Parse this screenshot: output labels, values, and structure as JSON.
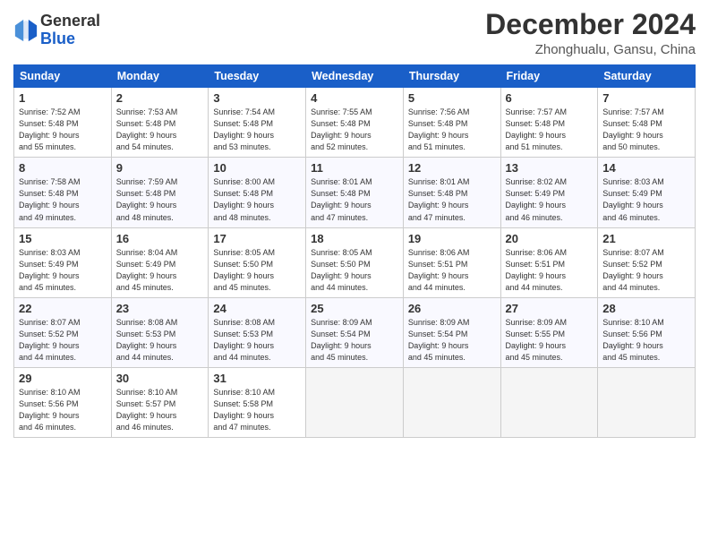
{
  "header": {
    "logo_line1": "General",
    "logo_line2": "Blue",
    "month_title": "December 2024",
    "location": "Zhonghualu, Gansu, China"
  },
  "days_of_week": [
    "Sunday",
    "Monday",
    "Tuesday",
    "Wednesday",
    "Thursday",
    "Friday",
    "Saturday"
  ],
  "weeks": [
    [
      {
        "day": "1",
        "sunrise": "7:52 AM",
        "sunset": "5:48 PM",
        "daylight_h": "9",
        "daylight_m": "55"
      },
      {
        "day": "2",
        "sunrise": "7:53 AM",
        "sunset": "5:48 PM",
        "daylight_h": "9",
        "daylight_m": "54"
      },
      {
        "day": "3",
        "sunrise": "7:54 AM",
        "sunset": "5:48 PM",
        "daylight_h": "9",
        "daylight_m": "53"
      },
      {
        "day": "4",
        "sunrise": "7:55 AM",
        "sunset": "5:48 PM",
        "daylight_h": "9",
        "daylight_m": "52"
      },
      {
        "day": "5",
        "sunrise": "7:56 AM",
        "sunset": "5:48 PM",
        "daylight_h": "9",
        "daylight_m": "51"
      },
      {
        "day": "6",
        "sunrise": "7:57 AM",
        "sunset": "5:48 PM",
        "daylight_h": "9",
        "daylight_m": "51"
      },
      {
        "day": "7",
        "sunrise": "7:57 AM",
        "sunset": "5:48 PM",
        "daylight_h": "9",
        "daylight_m": "50"
      }
    ],
    [
      {
        "day": "8",
        "sunrise": "7:58 AM",
        "sunset": "5:48 PM",
        "daylight_h": "9",
        "daylight_m": "49"
      },
      {
        "day": "9",
        "sunrise": "7:59 AM",
        "sunset": "5:48 PM",
        "daylight_h": "9",
        "daylight_m": "48"
      },
      {
        "day": "10",
        "sunrise": "8:00 AM",
        "sunset": "5:48 PM",
        "daylight_h": "9",
        "daylight_m": "48"
      },
      {
        "day": "11",
        "sunrise": "8:01 AM",
        "sunset": "5:48 PM",
        "daylight_h": "9",
        "daylight_m": "47"
      },
      {
        "day": "12",
        "sunrise": "8:01 AM",
        "sunset": "5:48 PM",
        "daylight_h": "9",
        "daylight_m": "47"
      },
      {
        "day": "13",
        "sunrise": "8:02 AM",
        "sunset": "5:49 PM",
        "daylight_h": "9",
        "daylight_m": "46"
      },
      {
        "day": "14",
        "sunrise": "8:03 AM",
        "sunset": "5:49 PM",
        "daylight_h": "9",
        "daylight_m": "46"
      }
    ],
    [
      {
        "day": "15",
        "sunrise": "8:03 AM",
        "sunset": "5:49 PM",
        "daylight_h": "9",
        "daylight_m": "45"
      },
      {
        "day": "16",
        "sunrise": "8:04 AM",
        "sunset": "5:49 PM",
        "daylight_h": "9",
        "daylight_m": "45"
      },
      {
        "day": "17",
        "sunrise": "8:05 AM",
        "sunset": "5:50 PM",
        "daylight_h": "9",
        "daylight_m": "45"
      },
      {
        "day": "18",
        "sunrise": "8:05 AM",
        "sunset": "5:50 PM",
        "daylight_h": "9",
        "daylight_m": "44"
      },
      {
        "day": "19",
        "sunrise": "8:06 AM",
        "sunset": "5:51 PM",
        "daylight_h": "9",
        "daylight_m": "44"
      },
      {
        "day": "20",
        "sunrise": "8:06 AM",
        "sunset": "5:51 PM",
        "daylight_h": "9",
        "daylight_m": "44"
      },
      {
        "day": "21",
        "sunrise": "8:07 AM",
        "sunset": "5:52 PM",
        "daylight_h": "9",
        "daylight_m": "44"
      }
    ],
    [
      {
        "day": "22",
        "sunrise": "8:07 AM",
        "sunset": "5:52 PM",
        "daylight_h": "9",
        "daylight_m": "44"
      },
      {
        "day": "23",
        "sunrise": "8:08 AM",
        "sunset": "5:53 PM",
        "daylight_h": "9",
        "daylight_m": "44"
      },
      {
        "day": "24",
        "sunrise": "8:08 AM",
        "sunset": "5:53 PM",
        "daylight_h": "9",
        "daylight_m": "44"
      },
      {
        "day": "25",
        "sunrise": "8:09 AM",
        "sunset": "5:54 PM",
        "daylight_h": "9",
        "daylight_m": "45"
      },
      {
        "day": "26",
        "sunrise": "8:09 AM",
        "sunset": "5:54 PM",
        "daylight_h": "9",
        "daylight_m": "45"
      },
      {
        "day": "27",
        "sunrise": "8:09 AM",
        "sunset": "5:55 PM",
        "daylight_h": "9",
        "daylight_m": "45"
      },
      {
        "day": "28",
        "sunrise": "8:10 AM",
        "sunset": "5:56 PM",
        "daylight_h": "9",
        "daylight_m": "45"
      }
    ],
    [
      {
        "day": "29",
        "sunrise": "8:10 AM",
        "sunset": "5:56 PM",
        "daylight_h": "9",
        "daylight_m": "46"
      },
      {
        "day": "30",
        "sunrise": "8:10 AM",
        "sunset": "5:57 PM",
        "daylight_h": "9",
        "daylight_m": "46"
      },
      {
        "day": "31",
        "sunrise": "8:10 AM",
        "sunset": "5:58 PM",
        "daylight_h": "9",
        "daylight_m": "47"
      },
      null,
      null,
      null,
      null
    ]
  ]
}
